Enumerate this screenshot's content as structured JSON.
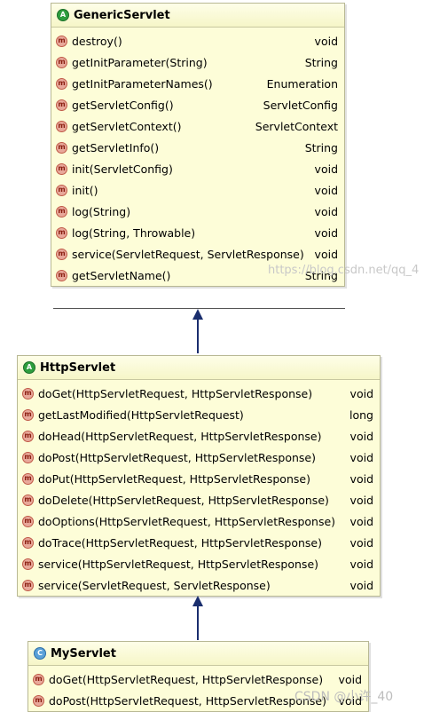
{
  "classes": {
    "generic": {
      "name": "GenericServlet",
      "methods": [
        {
          "name": "destroy()",
          "type": "void"
        },
        {
          "name": "getInitParameter(String)",
          "type": "String"
        },
        {
          "name": "getInitParameterNames()",
          "type": "Enumeration"
        },
        {
          "name": "getServletConfig()",
          "type": "ServletConfig"
        },
        {
          "name": "getServletContext()",
          "type": "ServletContext"
        },
        {
          "name": "getServletInfo()",
          "type": "String"
        },
        {
          "name": "init(ServletConfig)",
          "type": "void"
        },
        {
          "name": "init()",
          "type": "void"
        },
        {
          "name": "log(String)",
          "type": "void"
        },
        {
          "name": "log(String, Throwable)",
          "type": "void"
        },
        {
          "name": "service(ServletRequest, ServletResponse)",
          "type": "void"
        },
        {
          "name": "getServletName()",
          "type": "String"
        }
      ]
    },
    "http": {
      "name": "HttpServlet",
      "methods": [
        {
          "name": "doGet(HttpServletRequest, HttpServletResponse)",
          "type": "void"
        },
        {
          "name": "getLastModified(HttpServletRequest)",
          "type": "long"
        },
        {
          "name": "doHead(HttpServletRequest, HttpServletResponse)",
          "type": "void"
        },
        {
          "name": "doPost(HttpServletRequest, HttpServletResponse)",
          "type": "void"
        },
        {
          "name": "doPut(HttpServletRequest, HttpServletResponse)",
          "type": "void"
        },
        {
          "name": "doDelete(HttpServletRequest, HttpServletResponse)",
          "type": "void"
        },
        {
          "name": "doOptions(HttpServletRequest, HttpServletResponse)",
          "type": "void"
        },
        {
          "name": "doTrace(HttpServletRequest, HttpServletResponse)",
          "type": "void"
        },
        {
          "name": "service(HttpServletRequest, HttpServletResponse)",
          "type": "void"
        },
        {
          "name": "service(ServletRequest, ServletResponse)",
          "type": "void"
        }
      ]
    },
    "my": {
      "name": "MyServlet",
      "methods": [
        {
          "name": "doGet(HttpServletRequest, HttpServletResponse)",
          "type": "void"
        },
        {
          "name": "doPost(HttpServletRequest, HttpServletResponse)",
          "type": "void"
        }
      ]
    }
  },
  "watermarks": {
    "url": "https://blog.csdn.net/qq_4",
    "csdn": "CSDN @小许_40"
  },
  "colors": {
    "arrow": "#1a2e6e",
    "class_bg": "#fdfdd8",
    "method_icon": "#e8a89a"
  }
}
